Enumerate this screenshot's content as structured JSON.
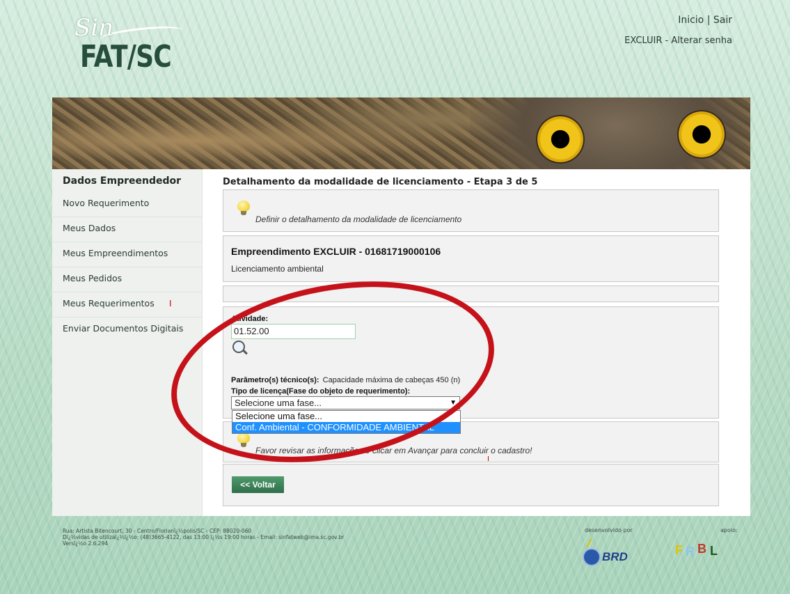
{
  "header": {
    "logo": {
      "script_text": "Sin",
      "main_text": "FAT/SC"
    },
    "links": {
      "inicio": "Inicio",
      "sep": "|",
      "sair": "Sair"
    },
    "account": {
      "user": "EXCLUIR",
      "sep": "-",
      "change_password": "Alterar senha"
    }
  },
  "sidebar": {
    "title": "Dados Empreendedor",
    "items": [
      {
        "label": "Novo Requerimento"
      },
      {
        "label": "Meus Dados"
      },
      {
        "label": "Meus Empreendimentos"
      },
      {
        "label": "Meus Pedidos"
      },
      {
        "label": "Meus Requerimentos",
        "mark": "I"
      },
      {
        "label": "Enviar Documentos Digitais"
      }
    ]
  },
  "main": {
    "title": "Detalhamento da modalidade de licenciamento - Etapa 3 de 5",
    "hint_top": "Definir o detalhamento da modalidade de licenciamento",
    "empreendimento": {
      "title": "Empreendimento EXCLUIR - 01681719000106",
      "subtitle": "Licenciamento ambiental"
    },
    "form": {
      "atividade_label": "Atividade:",
      "atividade_value": "01.52.00",
      "parametros_label": "Parâmetro(s) técnico(s):",
      "parametros_value": "Capacidade máxima de cabeças 450 (n)",
      "tipo_label": "Tipo de licença(Fase do objeto de requerimento):",
      "select_value": "Selecione uma fase...",
      "options": [
        {
          "label": "Selecione uma fase..."
        },
        {
          "label": "Conf. Ambiental - CONFORMIDADE AMBIENTAL"
        }
      ]
    },
    "hint_bottom": "Favor revisar as informações e clicar em Avançar para concluir o cadastro!",
    "back_button": "<< Voltar"
  },
  "footer": {
    "line1": "Rua: Artista Bitencourt, 30 - Centro/Florianï¿½polis/SC - CEP: 88020-060",
    "line2": "Dï¿½vidas de utilizaï¿½ï¿½o: (48)3665-4122, das 13:00 ï¿½s 19:00 horas - Email: sinfatweb@ima.sc.gov.br",
    "line3": "Versï¿½o 2.6.294",
    "developed_by": "desenvolvido por",
    "support": "apoio:",
    "brd_logo": "BRD",
    "support_logo": "FRBL"
  },
  "colors": {
    "accent_green": "#2f6f4a",
    "highlight_blue": "#1e90ff",
    "annotation_red": "#c5121a"
  }
}
